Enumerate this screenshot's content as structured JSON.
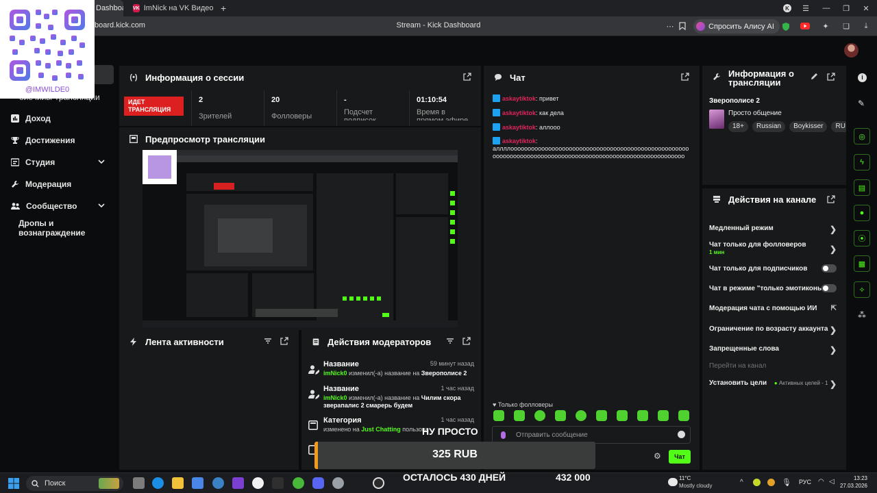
{
  "browser": {
    "tabs": [
      {
        "label": "Dashboard",
        "favicon": "kick-logo-icon",
        "active": true
      },
      {
        "label": "ImNick на VK Видео Live",
        "favicon": "vk-icon",
        "active": false
      }
    ],
    "new_tab": "+",
    "url": "dashboard.kick.com",
    "url_visible": "board.kick.com",
    "page_title": "Stream - Kick Dashboard",
    "alice_button": "Спросить Алису AI",
    "window_controls": [
      "minimize",
      "restore",
      "close"
    ]
  },
  "overlay": {
    "qr_handle": "@IMWILDE0",
    "donation": {
      "donor": "НУ ПРОСТО",
      "amount": "325 RUB",
      "remaining": "ОСТАЛОСЬ 430 ДНЕЙ",
      "goal": "432 000"
    }
  },
  "sidebar": {
    "partial_item": "Статистика трансляции",
    "partial_visible": "ойечийы Трансляции",
    "items": [
      {
        "label": "Доход",
        "icon": "bar-chart-icon",
        "has_chevron": false
      },
      {
        "label": "Достижения",
        "icon": "trophy-icon",
        "has_chevron": false
      },
      {
        "label": "Студия",
        "icon": "studio-icon",
        "has_chevron": true
      },
      {
        "label": "Модерация",
        "icon": "wrench-icon",
        "has_chevron": false
      },
      {
        "label": "Сообщество",
        "icon": "community-icon",
        "has_chevron": true
      },
      {
        "label": "Дропы и вознаграждение",
        "icon": "",
        "has_chevron": false
      }
    ]
  },
  "session": {
    "title": "Информация о сессии",
    "live_badge": "ИДЕТ ТРАНСЛЯЦИЯ",
    "live_line1": "ИДЕТ",
    "live_line2": "ТРАНСЛЯЦИЯ",
    "stats": [
      {
        "value": "2",
        "label": "Зрителей"
      },
      {
        "value": "20",
        "label": "Фолловеры"
      },
      {
        "value": "-",
        "label": "Подсчет подписок"
      },
      {
        "value": "01:10:54",
        "label": "Время в прямом эфире"
      }
    ]
  },
  "preview": {
    "title": "Предпросмотр трансляции"
  },
  "activity": {
    "title": "Лента активности"
  },
  "mod_actions": {
    "title": "Действия модераторов",
    "items": [
      {
        "icon": "user-edit-icon",
        "title": "Название",
        "time": "59 минут назад",
        "user": "imNick0",
        "action": " изменил(-а) название на ",
        "value": "Зверополисе 2"
      },
      {
        "icon": "user-edit-icon",
        "title": "Название",
        "time": "1 час назад",
        "user": "imNick0",
        "action": " изменил(-а) название на ",
        "value": "Чилим скора зверапалис 2 смарерь будем"
      },
      {
        "icon": "category-icon",
        "title": "Категория",
        "time": "1 час назад",
        "user": "",
        "action": "изменено на ",
        "value": "Just Chatting",
        "suffix": " пользова"
      }
    ]
  },
  "chat": {
    "title": "Чат",
    "messages": [
      {
        "user": "askaytiktok",
        "text": "привет"
      },
      {
        "user": "askaytiktok",
        "text": "как дела"
      },
      {
        "user": "askaytiktok",
        "text": "аллооо"
      },
      {
        "user": "askaytiktok",
        "text": "аллллоооооооооооооооооооооооооооооооооооооооооооооооооооооооооооооооооооооооооооооооооооооооооооооооооооооооооооо"
      }
    ],
    "mode_label": "Только фолловеры",
    "input_placeholder": "Отправить сообщение",
    "send_label": "Чат"
  },
  "stream_info": {
    "title": "Информация о трансляции",
    "stream_title": "Зверополисе 2",
    "category": "Просто общение",
    "tags": [
      "18+",
      "Russian",
      "Boykisser",
      "RU"
    ]
  },
  "channel_actions": {
    "title": "Действия на канале",
    "items": [
      {
        "label": "Медленный режим",
        "control": "arrow"
      },
      {
        "label": "Чат только для фолловеров",
        "sub": "1 мин",
        "control": "arrow"
      },
      {
        "label": "Чат только для подписчиков",
        "control": "toggle"
      },
      {
        "label": "Чат в режиме \"только эмотиконы\"",
        "control": "toggle"
      },
      {
        "label": "Модерация чата с помощью ИИ",
        "control": "external"
      },
      {
        "label": "Ограничение по возрасту аккаунта",
        "control": "arrow"
      },
      {
        "label": "Запрещенные слова",
        "control": "arrow"
      },
      {
        "label": "Перейти на канал",
        "control": "none",
        "disabled": true
      },
      {
        "label": "Установить цели",
        "sub": "Активных целей - 1",
        "control": "arrow"
      }
    ]
  },
  "right_rail": [
    "info-icon",
    "pencil-icon",
    "target-icon",
    "bolt-icon",
    "document-icon",
    "chat-bubble-icon",
    "broadcast-icon",
    "layout-icon",
    "wrench-icon",
    "share-icon"
  ],
  "taskbar": {
    "search_label": "Поиск",
    "weather_temp": "11°C",
    "weather_desc": "Mostly cloudy",
    "lang": "РУС",
    "time": "13:23",
    "date": "27.03.2026"
  },
  "colors": {
    "accent": "#53fc18",
    "live": "#dc1f1f",
    "panel": "#17191a",
    "background": "#0b0c0d",
    "chat_user": "#e0245e"
  }
}
